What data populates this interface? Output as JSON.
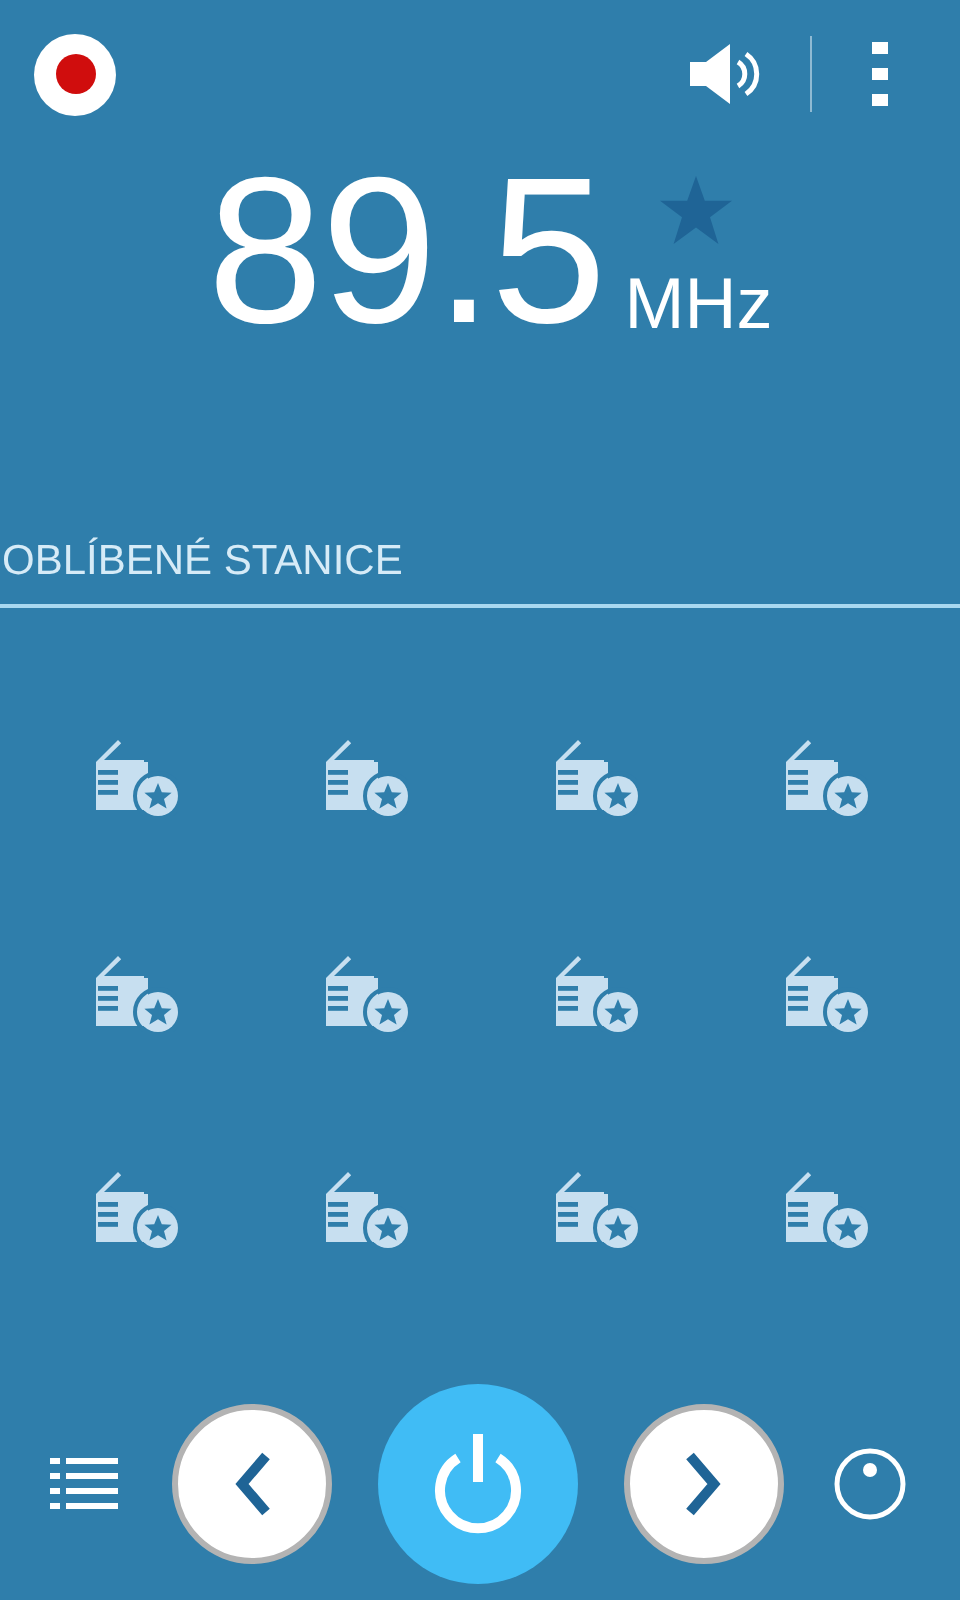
{
  "frequency": {
    "value": "89.5",
    "unit": "MHz",
    "favorite": false
  },
  "recording": false,
  "section_title": "OBLÍBENÉ STANICE",
  "presets": [
    {
      "kind": "empty"
    },
    {
      "kind": "empty"
    },
    {
      "kind": "empty"
    },
    {
      "kind": "empty"
    },
    {
      "kind": "empty"
    },
    {
      "kind": "empty"
    },
    {
      "kind": "empty"
    },
    {
      "kind": "empty"
    },
    {
      "kind": "empty"
    },
    {
      "kind": "empty"
    },
    {
      "kind": "empty"
    },
    {
      "kind": "empty"
    }
  ],
  "power": {
    "on": true
  }
}
